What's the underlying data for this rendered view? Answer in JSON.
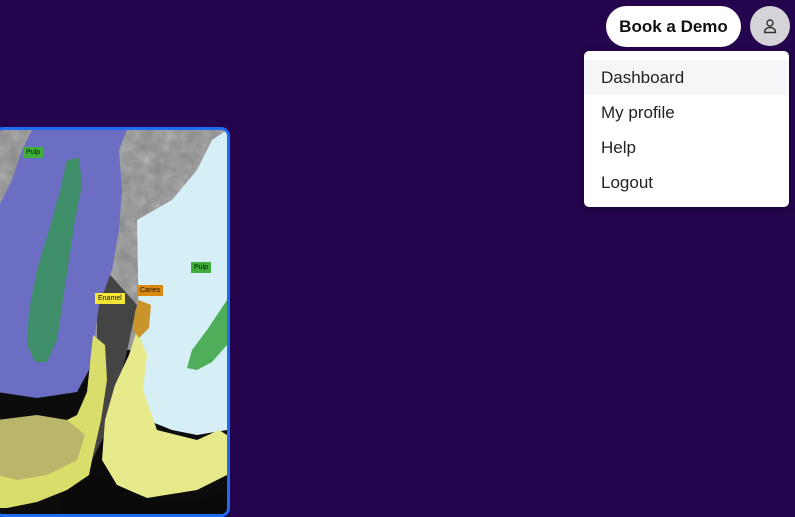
{
  "header": {
    "book_demo_label": "Book a Demo",
    "account_icon": "user-icon"
  },
  "menu": {
    "items": [
      {
        "label": "Dashboard",
        "active": true
      },
      {
        "label": "My profile",
        "active": false
      },
      {
        "label": "Help",
        "active": false
      },
      {
        "label": "Logout",
        "active": false
      }
    ]
  },
  "xray": {
    "labels": {
      "pulp_left": "Pulp",
      "pulp_right": "Pulp",
      "enamel": "Enamel",
      "caries": "Caries"
    },
    "colors": {
      "pulp": "#3fae3a",
      "enamel": "#f4e53a",
      "caries": "#d98a12",
      "frame": "#1d6cf2"
    }
  },
  "colors": {
    "background": "#24044d",
    "menu_active": "#f5f6f8"
  }
}
